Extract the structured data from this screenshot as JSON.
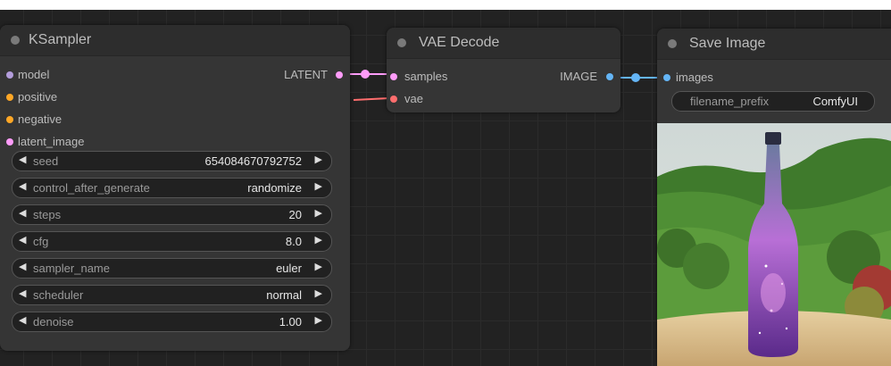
{
  "ksampler": {
    "title": "KSampler",
    "inputs": [
      {
        "label": "model",
        "color": "#b39ddb"
      },
      {
        "label": "positive",
        "color": "#ffa726"
      },
      {
        "label": "negative",
        "color": "#ffa726"
      },
      {
        "label": "latent_image",
        "color": "#ff9cf9"
      }
    ],
    "output": {
      "label": "LATENT",
      "color": "#ff9cf9"
    },
    "widgets": [
      {
        "label": "seed",
        "value": "654084670792752"
      },
      {
        "label": "control_after_generate",
        "value": "randomize"
      },
      {
        "label": "steps",
        "value": "20"
      },
      {
        "label": "cfg",
        "value": "8.0"
      },
      {
        "label": "sampler_name",
        "value": "euler"
      },
      {
        "label": "scheduler",
        "value": "normal"
      },
      {
        "label": "denoise",
        "value": "1.00"
      }
    ]
  },
  "vae_decode": {
    "title": "VAE Decode",
    "inputs": [
      {
        "label": "samples",
        "color": "#ff9cf9"
      },
      {
        "label": "vae",
        "color": "#ff6e6e"
      }
    ],
    "output": {
      "label": "IMAGE",
      "color": "#64b5f6"
    }
  },
  "save_image": {
    "title": "Save Image",
    "inputs": [
      {
        "label": "images",
        "color": "#64b5f6"
      }
    ],
    "filename_prefix": {
      "label": "filename_prefix",
      "value": "ComfyUI"
    },
    "preview_icon": "generated-image-bottle"
  },
  "colors": {
    "canvas": "#222222",
    "node_body": "#353535",
    "latent_wire": "#ff9cf9",
    "image_wire": "#64b5f6",
    "vae_wire": "#ff6e6e"
  }
}
